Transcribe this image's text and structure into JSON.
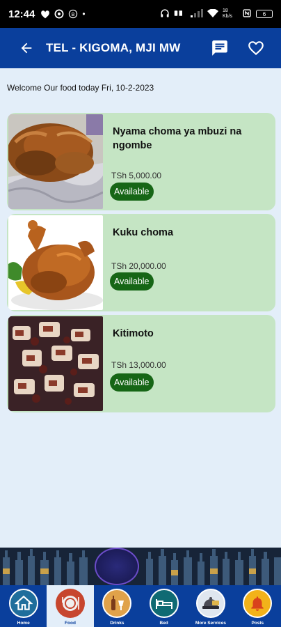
{
  "status_bar": {
    "time": "12:44",
    "battery": "6",
    "net_speed": "18 Kb/s"
  },
  "app_bar": {
    "title": "TEL - KIGOMA, MJI MW"
  },
  "welcome_text": "Welcome Our food today Fri, 10-2-2023",
  "foods": [
    {
      "name": "Nyama choma ya mbuzi na ngombe",
      "price": "TSh 5,000.00",
      "status": "Available"
    },
    {
      "name": "Kuku choma",
      "price": "TSh 20,000.00",
      "status": "Available"
    },
    {
      "name": "Kitimoto",
      "price": "TSh 13,000.00",
      "status": "Available"
    }
  ],
  "bottom_nav": [
    {
      "label": "Home",
      "icon": "home-icon"
    },
    {
      "label": "Food",
      "icon": "food-icon",
      "active": true
    },
    {
      "label": "Drinks",
      "icon": "drinks-icon"
    },
    {
      "label": "Bed",
      "icon": "bed-icon"
    },
    {
      "label": "More Services",
      "icon": "more-services-icon"
    },
    {
      "label": "Posts",
      "icon": "posts-icon"
    }
  ],
  "colors": {
    "app_bar": "#0a3f9c",
    "background": "#e3eef9",
    "card": "#c5e5c4",
    "available_badge": "#166616"
  }
}
